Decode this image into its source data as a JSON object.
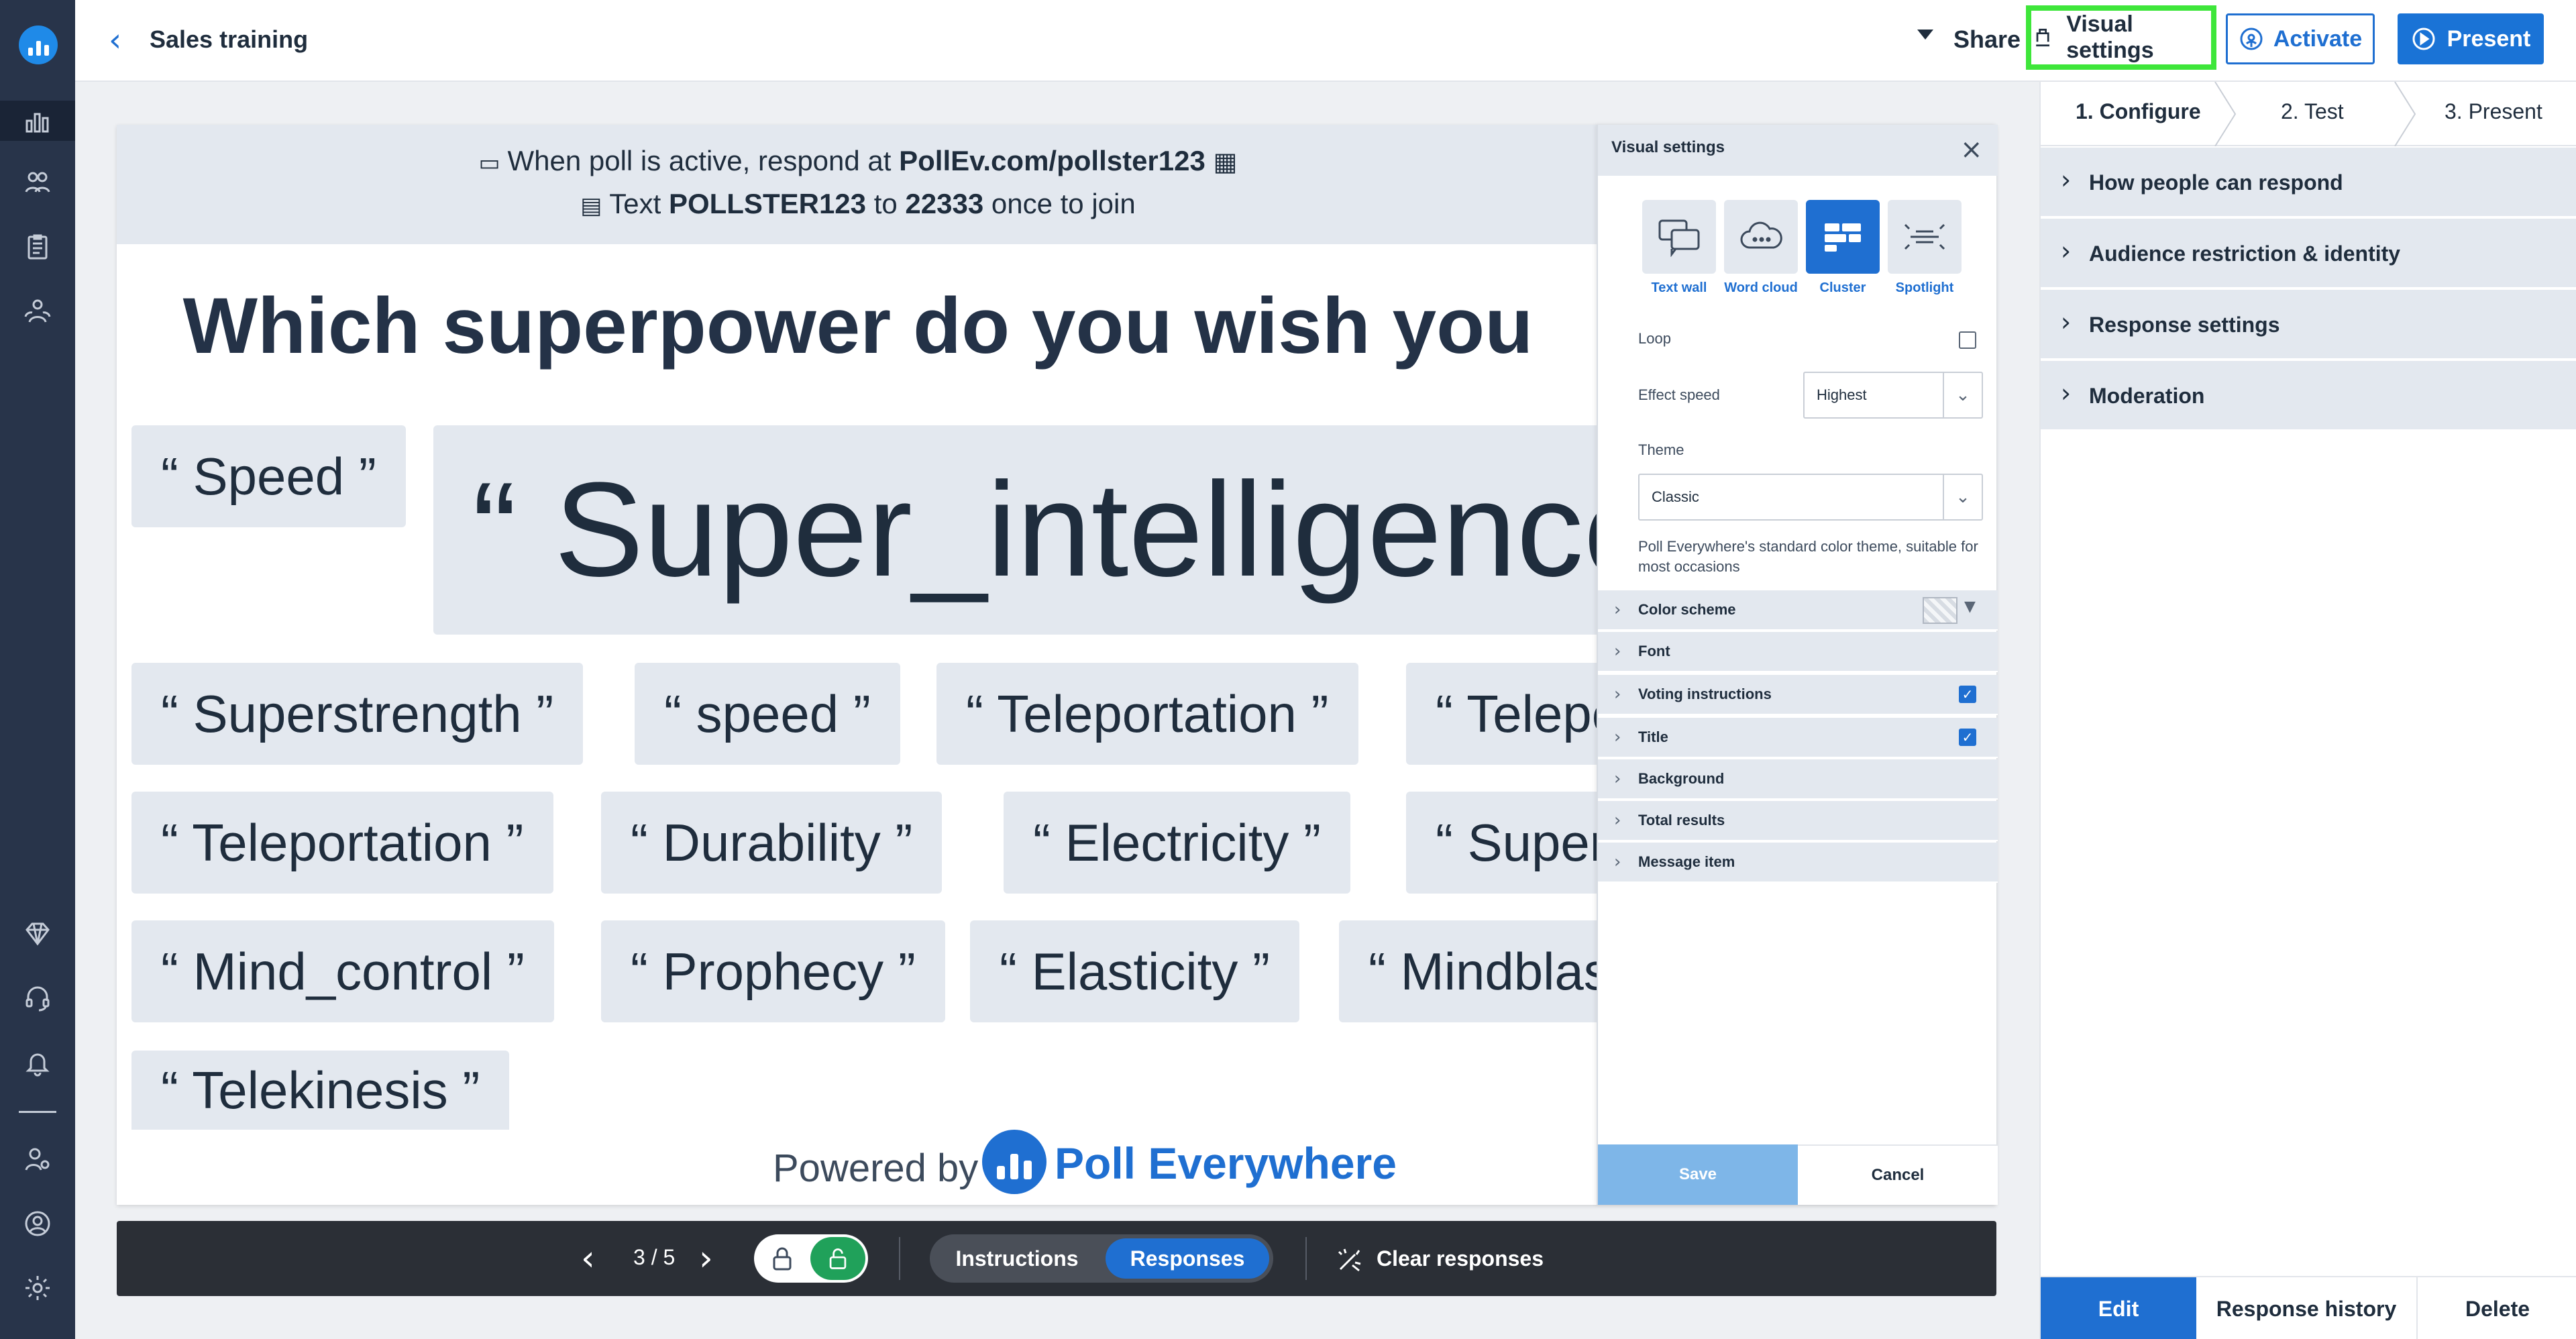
{
  "header": {
    "title": "Sales training",
    "share_label": "Share",
    "visual_settings_label": "Visual settings",
    "activate_label": "Activate",
    "present_label": "Present"
  },
  "stage": {
    "instructions": {
      "line1_prefix": "When poll is active, respond at ",
      "line1_url": "PollEv.com/pollster123",
      "line2_prefix": "Text ",
      "line2_code": "POLLSTER123",
      "line2_mid": " to ",
      "line2_number": "22333",
      "line2_suffix": " once to join"
    },
    "question": "Which superpower do you wish you",
    "responses": [
      "“ Speed ”",
      "“ Super_intelligence",
      "“ Superstrength ”",
      "“ speed ”",
      "“ Teleportation ”",
      "“ Telepo",
      "“ Teleportation ”",
      "“ Durability ”",
      "“ Electricity ”",
      "“ Super",
      "“ Mind_control ”",
      "“ Prophecy ”",
      "“ Elasticity ”",
      "“ Mindblas",
      "“ Telekinesis ”"
    ],
    "powered_by": "Powered by",
    "brand": "Poll Everywhere"
  },
  "visual_settings": {
    "title": "Visual settings",
    "types": [
      {
        "label": "Text wall",
        "icon": "text-wall-icon",
        "selected": false
      },
      {
        "label": "Word cloud",
        "icon": "word-cloud-icon",
        "selected": false
      },
      {
        "label": "Cluster",
        "icon": "cluster-icon",
        "selected": true
      },
      {
        "label": "Spotlight",
        "icon": "spotlight-icon",
        "selected": false
      }
    ],
    "loop_label": "Loop",
    "loop_checked": false,
    "effect_speed_label": "Effect speed",
    "effect_speed_value": "Highest",
    "theme_label": "Theme",
    "theme_value": "Classic",
    "theme_description": "Poll Everywhere's standard color theme, suitable for most occasions",
    "sections": [
      {
        "label": "Color scheme"
      },
      {
        "label": "Font"
      },
      {
        "label": "Voting instructions",
        "checked": true
      },
      {
        "label": "Title",
        "checked": true
      },
      {
        "label": "Background"
      },
      {
        "label": "Total results"
      },
      {
        "label": "Message item"
      }
    ],
    "save_label": "Save",
    "cancel_label": "Cancel"
  },
  "toolbar": {
    "page_counter": "3 / 5",
    "instructions_label": "Instructions",
    "responses_label": "Responses",
    "clear_label": "Clear responses"
  },
  "right_panel": {
    "steps": [
      "1. Configure",
      "2. Test",
      "3. Present"
    ],
    "sections": [
      "How people can respond",
      "Audience restriction & identity",
      "Response settings",
      "Moderation"
    ],
    "edit_label": "Edit",
    "history_label": "Response history",
    "delete_label": "Delete"
  },
  "colors": {
    "accent": "#1f6fd1",
    "rail": "#28344a",
    "highlight": "#3ee63a",
    "success": "#20a15a"
  }
}
